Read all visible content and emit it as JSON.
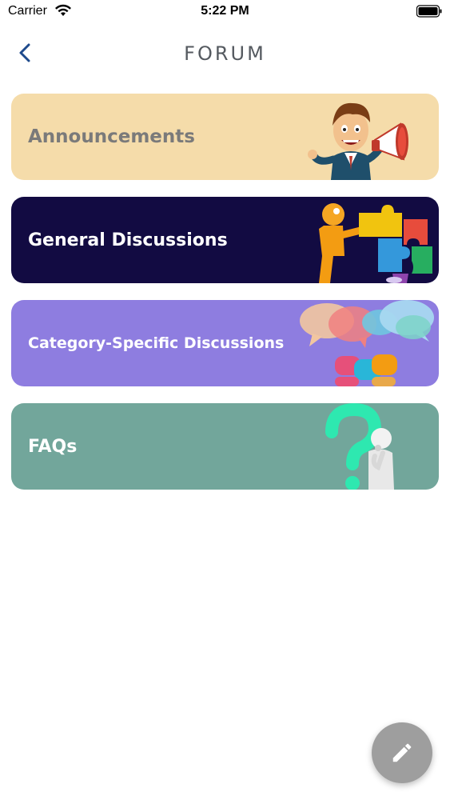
{
  "status_bar": {
    "carrier": "Carrier",
    "time": "5:22 PM"
  },
  "nav": {
    "title": "FORUM",
    "back_icon": "chevron-left-icon"
  },
  "categories": [
    {
      "label": "Announcements",
      "color": "#f5dcaa",
      "art": "megaphone-man-illustration"
    },
    {
      "label": "General Discussions",
      "color": "#120b42",
      "art": "puzzle-pieces-illustration"
    },
    {
      "label": "Category-Specific Discussions",
      "color": "#8e7de0",
      "art": "speech-bubbles-illustration"
    },
    {
      "label": "FAQs",
      "color": "#72a69b",
      "art": "question-mark-figure-illustration"
    }
  ],
  "fab": {
    "icon": "pencil-icon"
  },
  "colors": {
    "accent": "#1e4a8c",
    "fab": "#9e9e9e"
  }
}
